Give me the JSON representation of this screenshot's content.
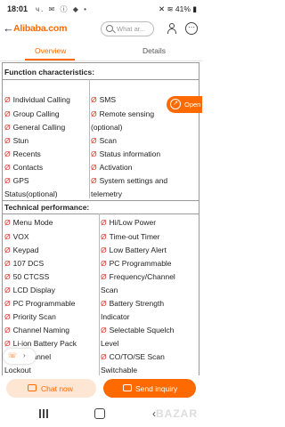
{
  "status_bar": {
    "time": "18:01",
    "left_indicators": "ч. ✉ ⓘ ◆ •",
    "right_indicators": "✕ ≋ 41% ▮"
  },
  "header": {
    "logo_text": "Alibaba.com",
    "search_placeholder": "What ar...",
    "more_label": "⋯"
  },
  "tabs": [
    {
      "label": "Overview",
      "active": true
    },
    {
      "label": "Details",
      "active": false
    }
  ],
  "specs": {
    "function_title": "Function characteristics:",
    "bullet": "Ø",
    "function_left": [
      "Individual Calling",
      "Group Calling",
      "General Calling",
      "Stun",
      "Recents",
      "Contacts",
      "GPS",
      "Status(optional)"
    ],
    "function_right": [
      "SMS",
      "Remote sensing",
      "(optional)",
      "Scan",
      "Status information",
      "Activation",
      "System settings and",
      "telemetry"
    ],
    "technical_title": "Technical performance:",
    "technical_left": [
      "Menu Mode",
      "VOX",
      "Keypad",
      "107 DCS",
      "50 CTCSS",
      "LCD Display",
      "PC Programmable",
      "Priority Scan",
      "Channel Naming",
      "Li-ion Battery Pack",
      "… Channel",
      "Lockout"
    ],
    "technical_right": [
      "Hi/Low Power",
      "Time-out Timer",
      "Low Battery Alert",
      "PC Programmable",
      "Frequency/Channel",
      "Scan",
      "Battery Strength",
      "Indicator",
      "Selectable Squelch",
      "Level",
      "CO/TO/SE Scan",
      "Switchable"
    ]
  },
  "open_button": {
    "label": "Open"
  },
  "floating_widget": {
    "icon": "☏",
    "chevron": "›"
  },
  "actions": {
    "chat": "Chat now",
    "inquiry": "Send inquiry"
  },
  "watermark": "BAZAR",
  "colors": {
    "accent": "#ff6a00",
    "bullet_red": "#d43c2b",
    "chat_bg": "#fde6d3"
  }
}
